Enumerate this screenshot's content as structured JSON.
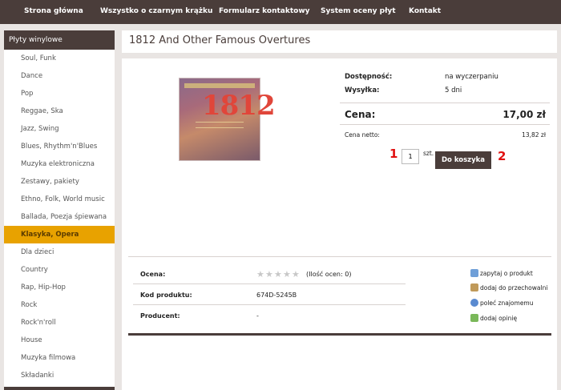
{
  "nav": {
    "items": [
      {
        "label": "Strona główna"
      },
      {
        "label": "Wszystko o czarnym krążku"
      },
      {
        "label": "Formularz kontaktowy"
      },
      {
        "label": "System oceny płyt"
      },
      {
        "label": "Kontakt"
      }
    ]
  },
  "sidebar": {
    "header": "Płyty winylowe",
    "items": [
      {
        "label": "Soul, Funk"
      },
      {
        "label": "Dance"
      },
      {
        "label": "Pop"
      },
      {
        "label": "Reggae, Ska"
      },
      {
        "label": "Jazz, Swing"
      },
      {
        "label": "Blues, Rhythm'n'Blues"
      },
      {
        "label": "Muzyka elektroniczna"
      },
      {
        "label": "Zestawy, pakiety"
      },
      {
        "label": "Ethno, Folk, World music"
      },
      {
        "label": "Ballada, Poezja śpiewana"
      },
      {
        "label": "Klasyka, Opera"
      },
      {
        "label": "Dla dzieci"
      },
      {
        "label": "Country"
      },
      {
        "label": "Rap, Hip-Hop"
      },
      {
        "label": "Rock"
      },
      {
        "label": "Rock'n'roll"
      },
      {
        "label": "House"
      },
      {
        "label": "Muzyka filmowa"
      },
      {
        "label": "Składanki"
      }
    ],
    "active_index": 10,
    "active_color": "#e8a200"
  },
  "product": {
    "title": "1812 And Other Famous Overtures",
    "cover_text": "1812",
    "availability_label": "Dostępność:",
    "availability_value": "na wyczerpaniu",
    "shipping_label": "Wysyłka:",
    "shipping_value": "5 dni",
    "price_label": "Cena:",
    "price_value": "17,00 zł",
    "net_label": "Cena netto:",
    "net_value": "13,82 zł",
    "quantity": "1",
    "unit": "szt.",
    "cart_button": "Do koszyka",
    "marker1": "1",
    "marker2": "2"
  },
  "details": {
    "rating_label": "Ocena:",
    "rating_stars": 0,
    "rating_max": 5,
    "rating_count": "(Ilość ocen: 0)",
    "code_label": "Kod produktu:",
    "code_value": "674D-5245B",
    "producer_label": "Producent:",
    "producer_value": "-"
  },
  "actions": [
    {
      "label": "zapytaj o produkt",
      "icon": "question-icon"
    },
    {
      "label": "dodaj do przechowalni",
      "icon": "storage-icon"
    },
    {
      "label": "poleć znajomemu",
      "icon": "person-icon"
    },
    {
      "label": "dodaj opinię",
      "icon": "opinion-icon"
    }
  ],
  "colors": {
    "brand_dark": "#4a3d3a",
    "accent": "#e8a200",
    "marker_red": "#e01010"
  }
}
